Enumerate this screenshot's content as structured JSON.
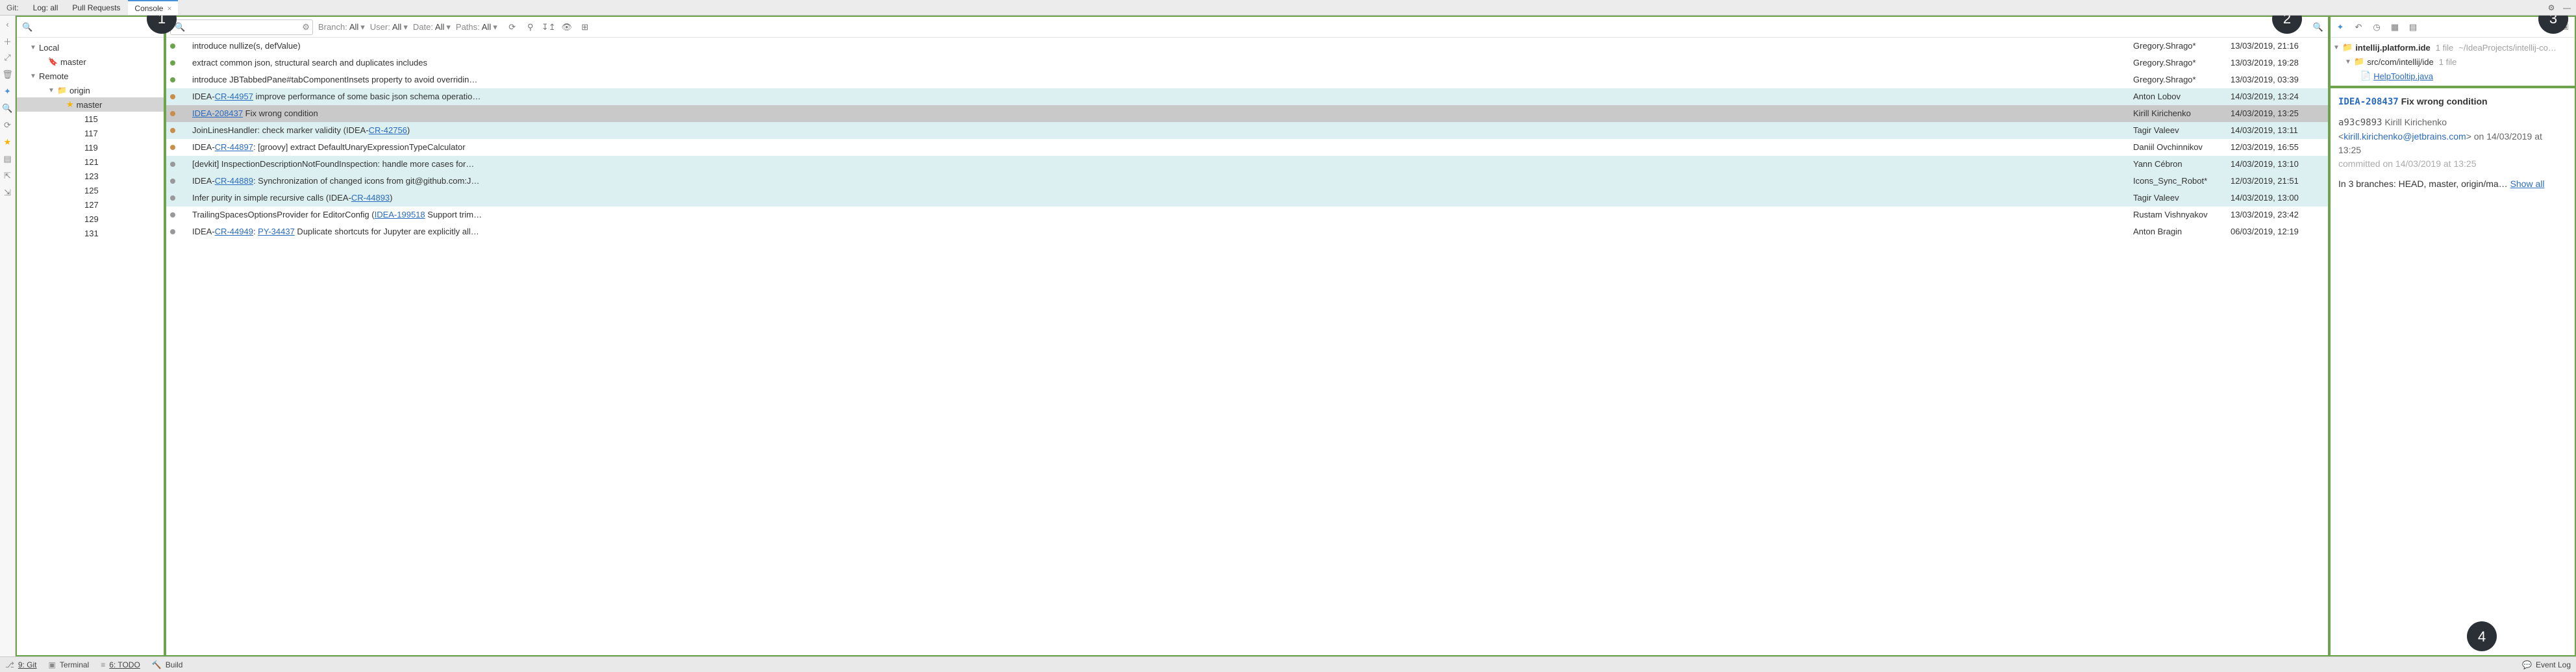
{
  "top_tabs": {
    "prefix": "Git:",
    "items": [
      {
        "label": "Log: all",
        "active": false
      },
      {
        "label": "Pull Requests",
        "active": false
      },
      {
        "label": "Console",
        "active": true
      }
    ]
  },
  "branch_tree": {
    "local_label": "Local",
    "remote_label": "Remote",
    "local_branches": [
      {
        "name": "master",
        "starred": true,
        "icon": "tag"
      }
    ],
    "remotes": [
      {
        "name": "origin",
        "branches": [
          {
            "name": "master",
            "starred": true,
            "selected": true
          },
          {
            "name": "115"
          },
          {
            "name": "117"
          },
          {
            "name": "119"
          },
          {
            "name": "121"
          },
          {
            "name": "123"
          },
          {
            "name": "125"
          },
          {
            "name": "127"
          },
          {
            "name": "129"
          },
          {
            "name": "131"
          }
        ]
      }
    ]
  },
  "log_filters": {
    "branch_label": "Branch:",
    "branch_value": "All",
    "user_label": "User:",
    "user_value": "All",
    "date_label": "Date:",
    "date_value": "All",
    "paths_label": "Paths:",
    "paths_value": "All"
  },
  "commits": [
    {
      "graph": "g",
      "msg_pre": "introduce nullize(s, defValue)",
      "link": "",
      "msg_post": "",
      "author": "Gregory.Shrago*",
      "date": "13/03/2019, 21:16"
    },
    {
      "graph": "g",
      "msg_pre": "extract common json, structural search and duplicates includes",
      "link": "",
      "msg_post": "",
      "author": "Gregory.Shrago*",
      "date": "13/03/2019, 19:28"
    },
    {
      "graph": "g",
      "msg_pre": "introduce JBTabbedPane#tabComponentInsets property to avoid overridin…",
      "link": "",
      "msg_post": "",
      "author": "Gregory.Shrago*",
      "date": "13/03/2019, 03:39"
    },
    {
      "graph": "o",
      "hl": true,
      "msg_pre": "IDEA-",
      "link": "CR-44957",
      "msg_post": " improve performance of some basic json schema operatio…",
      "author": "Anton Lobov",
      "date": "14/03/2019, 13:24"
    },
    {
      "graph": "o",
      "sel": true,
      "msg_pre": "",
      "link": "IDEA-208437",
      "msg_post": " Fix wrong condition",
      "author": "Kirill Kirichenko",
      "date": "14/03/2019, 13:25"
    },
    {
      "graph": "o",
      "hl": true,
      "msg_pre": "JoinLinesHandler: check marker validity (IDEA-",
      "link": "CR-42756",
      "msg_post": ")",
      "author": "Tagir Valeev",
      "date": "14/03/2019, 13:11"
    },
    {
      "graph": "o",
      "msg_pre": "IDEA-",
      "link": "CR-44897",
      "msg_post": ": [groovy] extract DefaultUnaryExpressionTypeCalculator",
      "author": "Daniil Ovchinnikov",
      "date": "12/03/2019, 16:55"
    },
    {
      "graph": "b",
      "hl": true,
      "msg_pre": "[devkit] InspectionDescriptionNotFoundInspection: handle more cases for…",
      "link": "",
      "msg_post": "",
      "author": "Yann Cébron",
      "date": "14/03/2019, 13:10"
    },
    {
      "graph": "b",
      "hl": true,
      "msg_pre": "IDEA-",
      "link": "CR-44889",
      "msg_post": ": Synchronization of changed icons from git@github.com:J…",
      "author": "Icons_Sync_Robot*",
      "date": "12/03/2019, 21:51"
    },
    {
      "graph": "b",
      "hl": true,
      "msg_pre": "Infer purity in simple recursive calls (IDEA-",
      "link": "CR-44893",
      "msg_post": ")",
      "author": "Tagir Valeev",
      "date": "14/03/2019, 13:00"
    },
    {
      "graph": "b",
      "msg_pre": "TrailingSpacesOptionsProvider for EditorConfig (",
      "link": "IDEA-199518",
      "msg_post": " Support trim…",
      "author": "Rustam Vishnyakov",
      "date": "13/03/2019, 23:42"
    },
    {
      "graph": "b",
      "msg_pre": "IDEA-",
      "link": "CR-44949",
      "msg_post_pre": ": ",
      "link2": "PY-34437",
      "msg_post": " Duplicate shortcuts for Jupyter are explicitly all…",
      "author": "Anton Bragin",
      "date": "06/03/2019, 12:19"
    }
  ],
  "changed_files": {
    "root": {
      "name": "intellij.platform.ide",
      "count": "1 file",
      "path": "~/IdeaProjects/intellij-co…"
    },
    "dir": {
      "name": "src/com/intellij/ide",
      "count": "1 file"
    },
    "file": {
      "name": "HelpTooltip.java"
    }
  },
  "commit_detail": {
    "id": "IDEA-208437",
    "title": "Fix wrong condition",
    "hash": "a93c9893",
    "author": "Kirill Kirichenko",
    "email": "kirill.kirichenko@jetbrains.com",
    "on_label": "on",
    "date": "14/03/2019",
    "at_label": "at",
    "time": "13:25",
    "committed_label": "committed on 14/03/2019 at 13:25",
    "branches_label": "In 3 branches: HEAD, master, origin/ma…",
    "show_all": "Show all"
  },
  "statusbar": {
    "git": "9: Git",
    "terminal": "Terminal",
    "todo": "6: TODO",
    "build": "Build",
    "event_log": "Event Log"
  },
  "callouts": {
    "c1": "1",
    "c2": "2",
    "c3": "3",
    "c4": "4"
  }
}
